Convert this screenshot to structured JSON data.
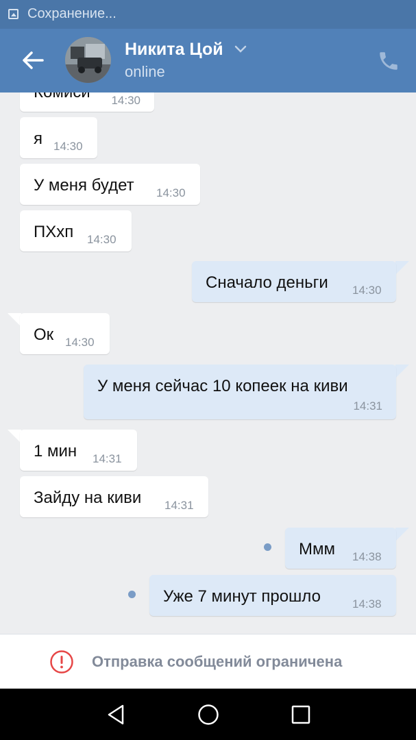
{
  "status_bar": {
    "text": "Сохранение...",
    "icon": "image-save-icon"
  },
  "header": {
    "name": "Никита Цой",
    "status": "online",
    "icons": [
      "back-arrow-icon",
      "chevron-down-icon",
      "phone-icon"
    ]
  },
  "messages": [
    {
      "direction": "in",
      "text": "Комиси",
      "time": "14:30"
    },
    {
      "direction": "in",
      "text": "я",
      "time": "14:30"
    },
    {
      "direction": "in",
      "text": "У меня будет",
      "time": "14:30"
    },
    {
      "direction": "in",
      "text": "ПХхп",
      "time": "14:30"
    },
    {
      "direction": "out",
      "text": "Сначало деньги",
      "time": "14:30"
    },
    {
      "direction": "in",
      "text": "Ок",
      "time": "14:30"
    },
    {
      "direction": "out",
      "text": "У меня сейчас 10 копеек на киви",
      "time": "14:31"
    },
    {
      "direction": "in",
      "text": "1 мин",
      "time": "14:31"
    },
    {
      "direction": "in",
      "text": "Зайду на киви",
      "time": "14:31"
    },
    {
      "direction": "out",
      "text": "Ммм",
      "time": "14:38",
      "unread": true
    },
    {
      "direction": "out",
      "text": "Уже 7 минут прошло",
      "time": "14:38",
      "unread": true
    }
  ],
  "composer": {
    "notice": "Отправка сообщений ограничена",
    "icon": "warning-icon"
  },
  "nav_bar": {
    "icons": [
      "nav-back-icon",
      "nav-home-icon",
      "nav-recents-icon"
    ]
  },
  "colors": {
    "header": "#5181b8",
    "status_bar": "#4a76a8",
    "outgoing_bubble": "#dde9f7",
    "incoming_bubble": "#ffffff",
    "background": "#edeef0",
    "warning": "#e64646"
  }
}
